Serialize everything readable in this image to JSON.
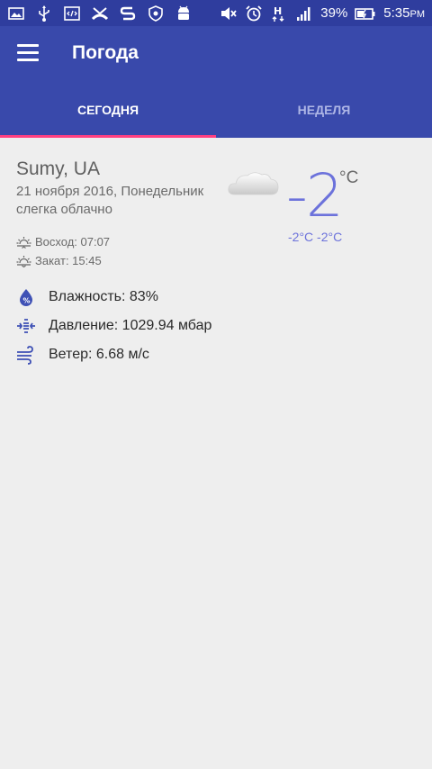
{
  "status_bar": {
    "battery": "39%",
    "time": "5:35",
    "ampm": "PM",
    "network": "H"
  },
  "app_bar": {
    "title": "Погода"
  },
  "tabs": [
    {
      "label": "СЕГОДНЯ",
      "active": true
    },
    {
      "label": "НЕДЕЛЯ",
      "active": false
    }
  ],
  "weather": {
    "city": "Sumy, UA",
    "date": "21 ноября 2016, Понедельник",
    "description": "слегка облачно",
    "sunrise": "Восход: 07:07",
    "sunset": "Закат: 15:45",
    "temperature": "-2",
    "unit": "°C",
    "min_max": "-2°C -2°C",
    "icon": "cloud-icon"
  },
  "details": {
    "humidity": "Влажность: 83%",
    "pressure": "Давление: 1029.94 мбар",
    "wind": "Ветер: 6.68 м/с"
  },
  "colors": {
    "status_bar": "#2f3d9e",
    "app_bar": "#3949ab",
    "tab_indicator": "#ff4081",
    "temperature": "#6c72db",
    "background": "#eeeeee"
  }
}
